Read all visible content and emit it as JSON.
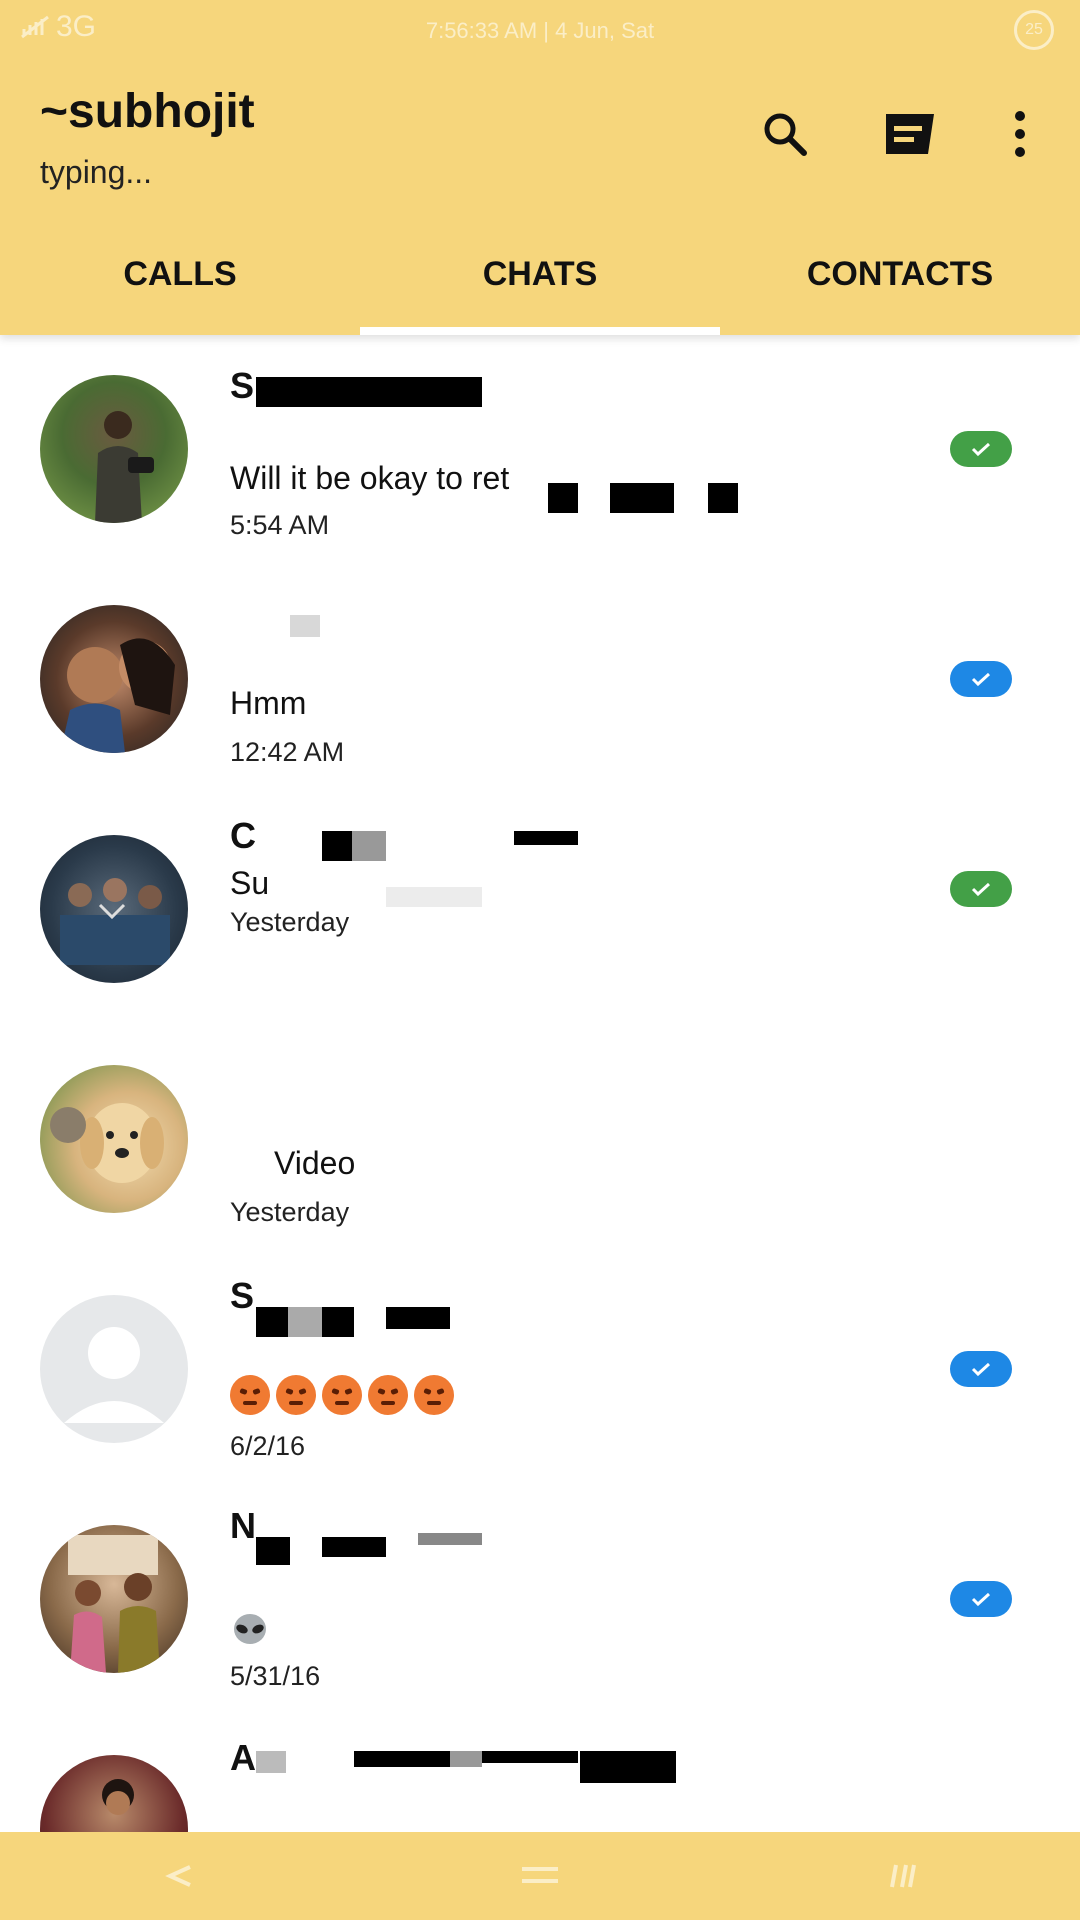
{
  "status_bar": {
    "network": "3G",
    "datetime": "7:56:33 AM | 4 Jun, Sat",
    "battery": "25"
  },
  "header": {
    "title": "~subhojit",
    "subtitle": "typing...",
    "icons": [
      "search-icon",
      "new-chat-icon",
      "more-vert-icon"
    ]
  },
  "tabs": [
    {
      "label": "CALLS",
      "selected": false
    },
    {
      "label": "CHATS",
      "selected": true
    },
    {
      "label": "CONTACTS",
      "selected": false
    }
  ],
  "chats": [
    {
      "name": "S",
      "preview": "Will it be okay to ret",
      "time": "5:54 AM",
      "badge_color": "#43a047"
    },
    {
      "name": "",
      "preview": "Hmm",
      "time": "12:42 AM",
      "badge_color": "#1e88e5"
    },
    {
      "name": "C",
      "preview": "Su",
      "time": "Yesterday",
      "badge_color": "#43a047"
    },
    {
      "name": "",
      "preview": "Video",
      "time": "Yesterday",
      "badge_color": ""
    },
    {
      "name": "S",
      "preview": "",
      "time": "6/2/16",
      "badge_color": "#1e88e5"
    },
    {
      "name": "N",
      "preview": "",
      "time": "5/31/16",
      "badge_color": "#1e88e5"
    },
    {
      "name": "A",
      "preview": "",
      "time": "",
      "badge_color": ""
    }
  ],
  "colors": {
    "app_bar": "#f6d67c",
    "read_green": "#43a047",
    "read_blue": "#1e88e5"
  },
  "nav_bar": {
    "icons": [
      "back-icon",
      "home-icon",
      "recents-icon"
    ]
  }
}
